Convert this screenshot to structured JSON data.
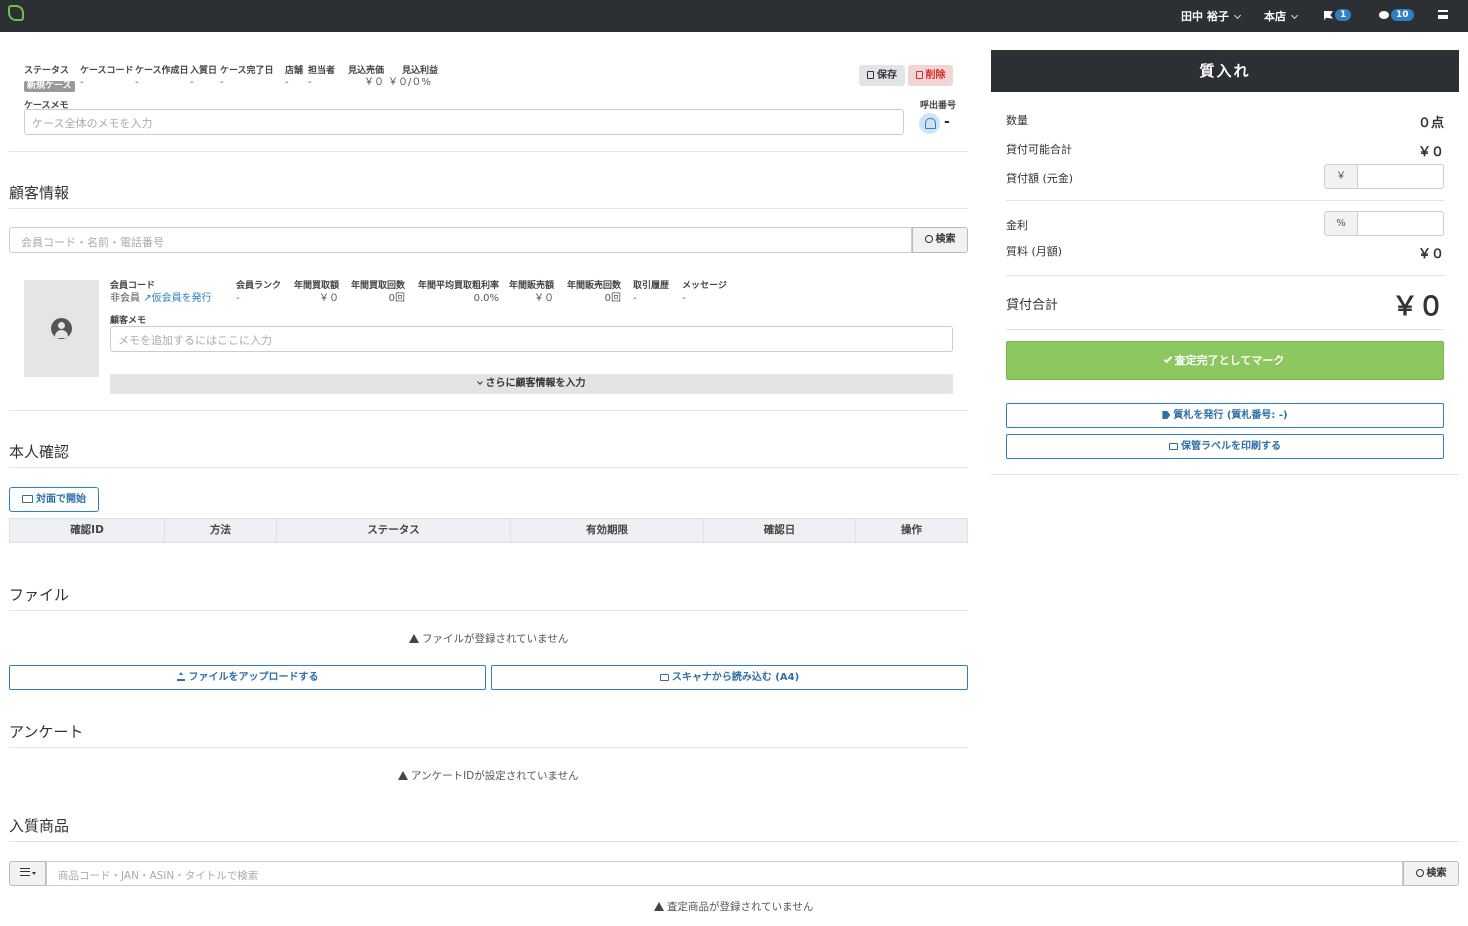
{
  "topnav": {
    "user": "田中 裕子",
    "store": "本店",
    "flag_count": "1",
    "message_count": "10"
  },
  "case": {
    "labels": {
      "status": "ステータス",
      "code": "ケースコード",
      "created": "ケース作成日",
      "pawned": "入質日",
      "completed": "ケース完了日",
      "store": "店舗",
      "staff": "担当者",
      "expected_sales": "見込売価",
      "expected_profit": "見込利益"
    },
    "values": {
      "status": "新規ケース",
      "code": "-",
      "created": "-",
      "pawned": "-",
      "completed": "-",
      "store": "-",
      "staff": "-",
      "expected_sales": "￥０",
      "expected_profit": "￥０/０%"
    },
    "save_label": "保存",
    "delete_label": "削除",
    "memo_label": "ケースメモ",
    "memo_placeholder": "ケース全体のメモを入力",
    "call_number_label": "呼出番号",
    "call_number_value": "-"
  },
  "customer": {
    "title": "顧客情報",
    "search_placeholder": "会員コード・名前・電話番号",
    "search_button": "検索",
    "labels": {
      "member_code": "会員コード",
      "rank": "会員ランク",
      "annual_purchase": "年間買取額",
      "annual_purchase_count": "年間買取回数",
      "avg_margin": "年間平均買取粗利率",
      "annual_sales": "年間販売額",
      "annual_sales_count": "年間販売回数",
      "history": "取引履歴",
      "message": "メッセージ"
    },
    "values": {
      "member_code": "非会員",
      "issue_temp_member": "仮会員を発行",
      "rank": "-",
      "annual_purchase": "￥０",
      "annual_purchase_count": "0回",
      "avg_margin": "0.0%",
      "annual_sales": "￥０",
      "annual_sales_count": "0回",
      "history": "-",
      "message": "-"
    },
    "memo_label": "顧客メモ",
    "memo_placeholder": "メモを追加するにはここに入力",
    "more_button": "さらに顧客情報を入力"
  },
  "identity": {
    "title": "本人確認",
    "start_button": "対面で開始",
    "columns": [
      "確認ID",
      "方法",
      "ステータス",
      "有効期限",
      "確認日",
      "操作"
    ]
  },
  "files": {
    "title": "ファイル",
    "empty_notice": "ファイルが登録されていません",
    "upload_button": "ファイルをアップロードする",
    "scan_button": "スキャナから読み込む (A4)"
  },
  "survey": {
    "title": "アンケート",
    "empty_notice": "アンケートIDが設定されていません"
  },
  "items": {
    "title": "入質商品",
    "search_placeholder": "商品コード・JAN・ASIN・タイトルで検索",
    "search_button": "検索",
    "empty_notice": "査定商品が登録されていません"
  },
  "panel": {
    "title": "質入れ",
    "quantity_label": "数量",
    "quantity_value": "０点",
    "loanable_label": "貸付可能合計",
    "loanable_value": "￥０",
    "loan_amount_label": "貸付額 (元金)",
    "yen_addon": "￥",
    "interest_label": "金利",
    "percent_addon": "%",
    "fee_label": "質料 (月額)",
    "fee_value": "￥０",
    "total_label": "貸付合計",
    "total_value": "￥０",
    "complete_button": "査定完了としてマーク",
    "issue_ticket_button": "質札を発行 (質札番号: -)",
    "print_label_button": "保管ラベルを印刷する"
  }
}
